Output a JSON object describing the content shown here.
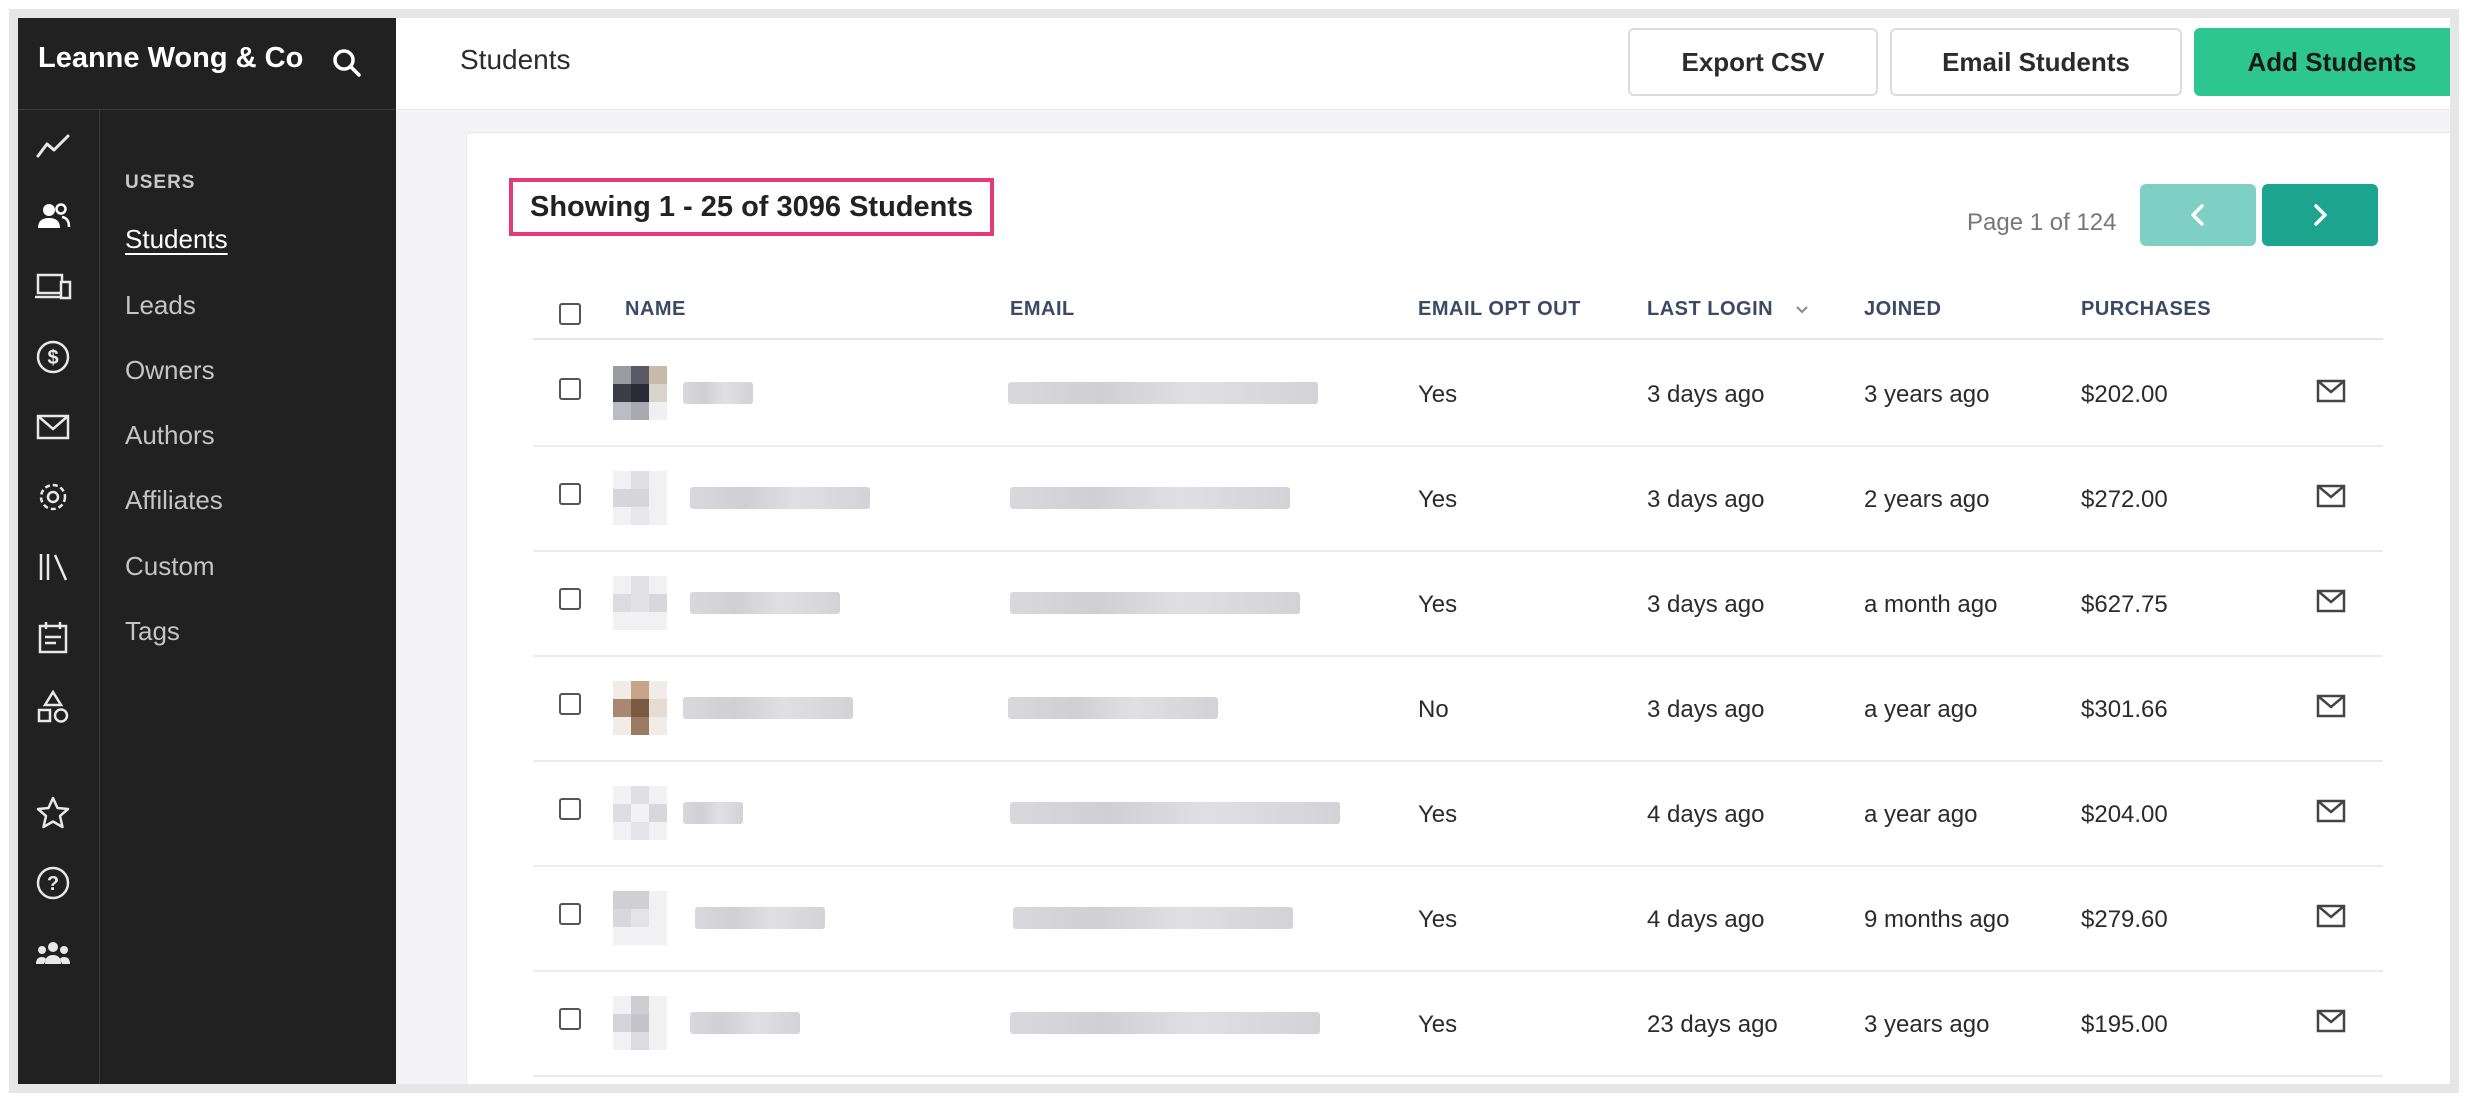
{
  "app": {
    "brand": "Leanne Wong & Co"
  },
  "header": {
    "title": "Students",
    "export_label": "Export CSV",
    "email_label": "Email Students",
    "add_label": "Add Students"
  },
  "subnav": {
    "heading": "USERS",
    "items": [
      "Students",
      "Leads",
      "Owners",
      "Authors",
      "Affiliates",
      "Custom",
      "Tags"
    ],
    "active": "Students"
  },
  "rail_icons": [
    "analytics-icon",
    "users-icon",
    "devices-icon",
    "dollar-icon",
    "mail-icon",
    "gear-icon",
    "library-icon",
    "calendar-icon",
    "shapes-icon",
    "star-icon",
    "help-icon",
    "community-icon"
  ],
  "listing": {
    "showing": "Showing 1 - 25 of 3096 Students",
    "page_info": "Page 1 of 124"
  },
  "table": {
    "columns": [
      "NAME",
      "EMAIL",
      "EMAIL OPT OUT",
      "LAST LOGIN",
      "JOINED",
      "PURCHASES"
    ],
    "sorted_column": "LAST LOGIN",
    "rows": [
      {
        "opt_out": "Yes",
        "last_login": "3 days ago",
        "joined": "3 years ago",
        "purchases": "$202.00"
      },
      {
        "opt_out": "Yes",
        "last_login": "3 days ago",
        "joined": "2 years ago",
        "purchases": "$272.00"
      },
      {
        "opt_out": "Yes",
        "last_login": "3 days ago",
        "joined": "a month ago",
        "purchases": "$627.75"
      },
      {
        "opt_out": "No",
        "last_login": "3 days ago",
        "joined": "a year ago",
        "purchases": "$301.66"
      },
      {
        "opt_out": "Yes",
        "last_login": "4 days ago",
        "joined": "a year ago",
        "purchases": "$204.00"
      },
      {
        "opt_out": "Yes",
        "last_login": "4 days ago",
        "joined": "9 months ago",
        "purchases": "$279.60"
      },
      {
        "opt_out": "Yes",
        "last_login": "23 days ago",
        "joined": "3 years ago",
        "purchases": "$195.00"
      }
    ]
  },
  "colors": {
    "sidebar": "#212121",
    "primary_button": "#2ec690",
    "pager_next": "#1da48e",
    "pager_prev": "#7ed0c4",
    "highlight_box": "#e33a7a"
  }
}
